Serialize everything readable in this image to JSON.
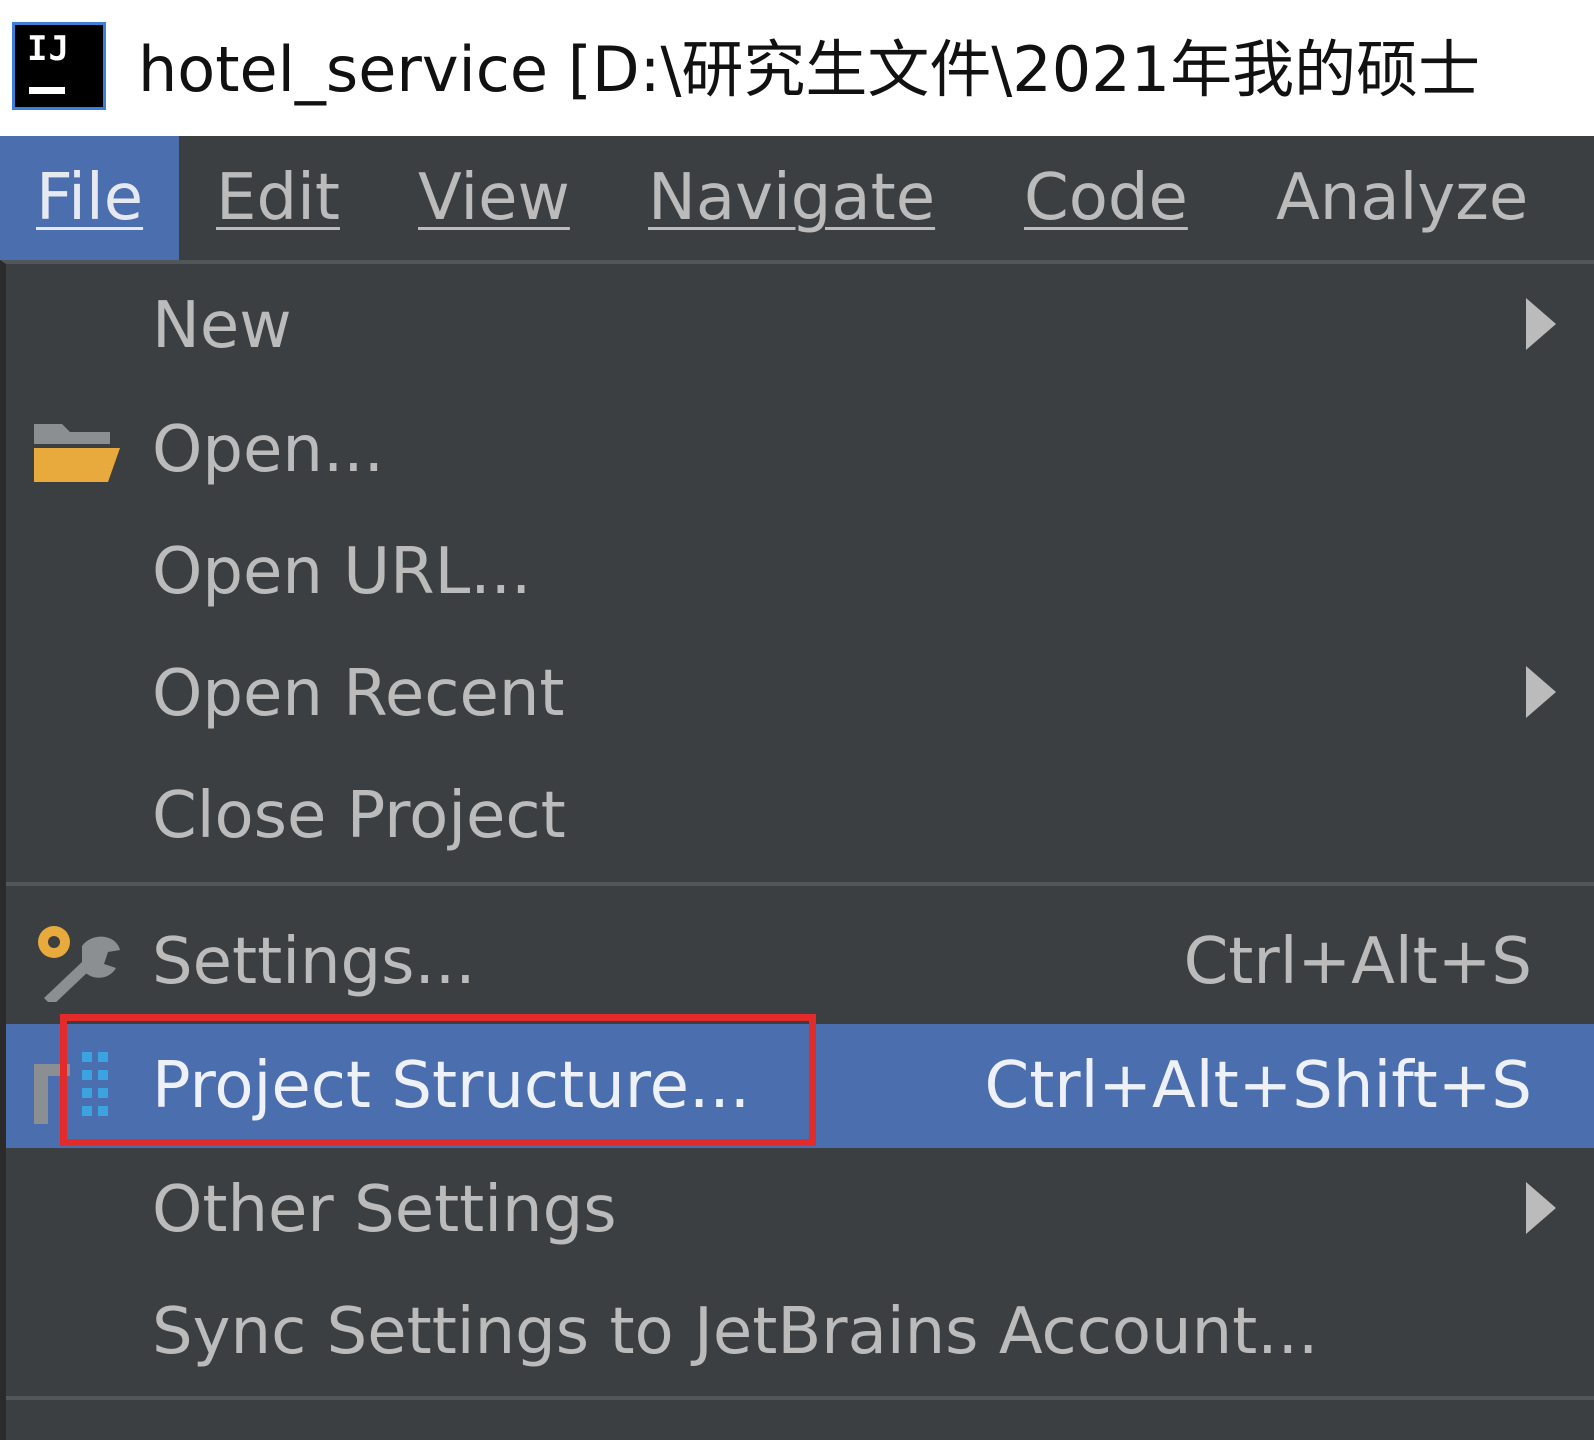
{
  "window": {
    "logo_text": "IJ",
    "title": "hotel_service [D:\\研究生文件\\2021年我的硕士"
  },
  "menubar": {
    "items": [
      {
        "label": "File",
        "mnemonic_index": 0,
        "active": true
      },
      {
        "label": "Edit",
        "mnemonic_index": 0
      },
      {
        "label": "View",
        "mnemonic_index": 0
      },
      {
        "label": "Navigate",
        "mnemonic_index": 0
      },
      {
        "label": "Code",
        "mnemonic_index": 0
      },
      {
        "label": "Analyze",
        "mnemonic_index": 5
      }
    ]
  },
  "file_menu": {
    "items": [
      {
        "label": "New",
        "icon": null,
        "shortcut": "",
        "submenu": true
      },
      {
        "label": "Open...",
        "icon": "folder-icon",
        "shortcut": "",
        "submenu": false
      },
      {
        "label": "Open URL...",
        "icon": null,
        "shortcut": "",
        "submenu": false
      },
      {
        "label": "Open Recent",
        "icon": null,
        "shortcut": "",
        "submenu": true
      },
      {
        "label": "Close Project",
        "icon": null,
        "shortcut": "",
        "submenu": false
      },
      {
        "label": "Settings...",
        "icon": "settings-wrench-icon",
        "shortcut": "Ctrl+Alt+S",
        "submenu": false
      },
      {
        "label": "Project Structure...",
        "icon": "project-structure-icon",
        "shortcut": "Ctrl+Alt+Shift+S",
        "submenu": false,
        "highlighted": true
      },
      {
        "label": "Other Settings",
        "icon": null,
        "shortcut": "",
        "submenu": true
      },
      {
        "label": "Sync Settings to JetBrains Account...",
        "icon": null,
        "shortcut": "",
        "submenu": false
      }
    ]
  },
  "colors": {
    "menu_bg": "#3c3f41",
    "selection": "#4b6eaf",
    "text": "#bbbbbb",
    "annotation_red": "#e32b2b"
  }
}
